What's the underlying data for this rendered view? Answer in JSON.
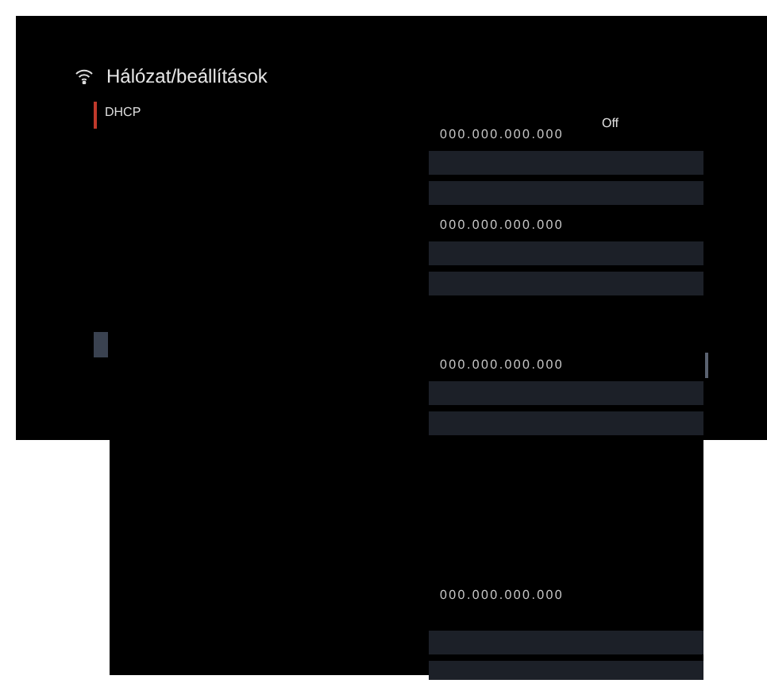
{
  "header": {
    "title": "Hálózat/beállítások"
  },
  "dhcp": {
    "label": "DHCP",
    "state": "Off",
    "selected": true
  },
  "sections": [
    {
      "groups": [
        {
          "address": "000.000.000.000"
        },
        {
          "address": "000.000.000.000"
        },
        {
          "address": "000.000.000.000"
        }
      ]
    },
    {
      "groups": [
        {
          "address": "000.000.000.000"
        }
      ]
    }
  ]
}
